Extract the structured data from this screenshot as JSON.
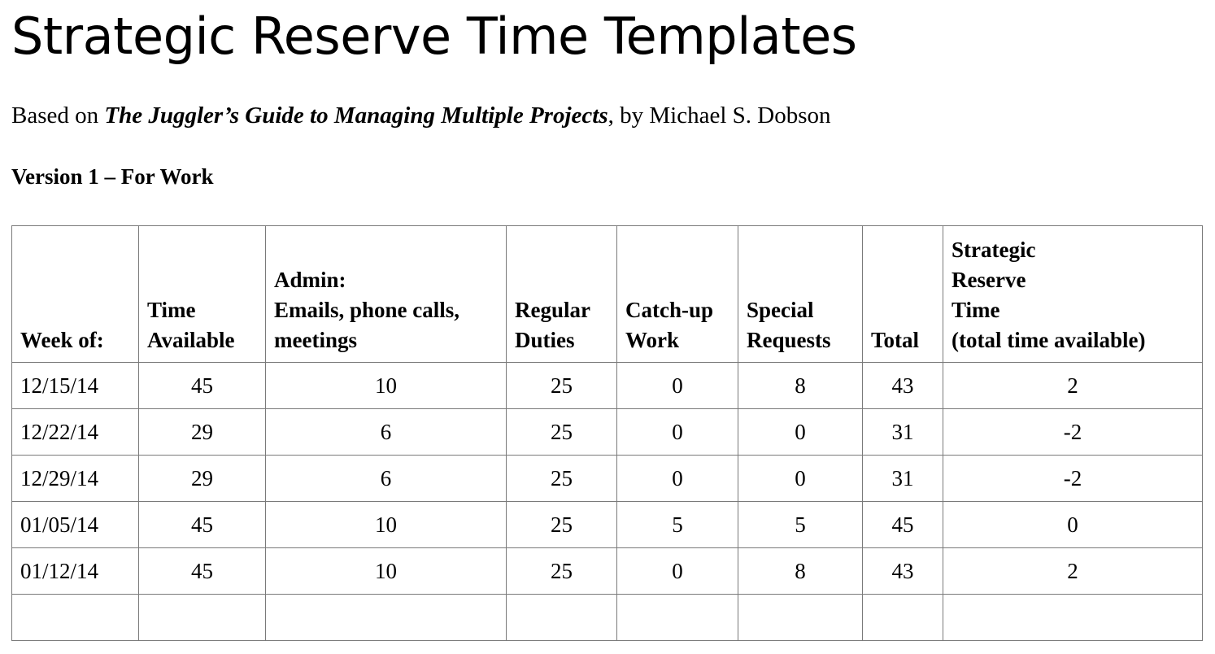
{
  "document": {
    "title": "Strategic Reserve Time Templates",
    "byline": {
      "prefix": "Based on ",
      "book_title": "The Juggler’s Guide to Managing Multiple Projects",
      "suffix": ", by Michael S. Dobson"
    },
    "section_heading": "Version 1 – For Work"
  },
  "table": {
    "headers": {
      "week": [
        "Week of:"
      ],
      "time_available": [
        "Time",
        "Available"
      ],
      "admin": [
        "Admin:",
        "Emails, phone calls,",
        "meetings"
      ],
      "regular_duties": [
        "Regular",
        "Duties"
      ],
      "catch_up": [
        "Catch-up",
        "Work"
      ],
      "special_requests": [
        "Special",
        "Requests"
      ],
      "total": [
        "Total"
      ],
      "strategic_reserve": [
        "Strategic",
        "Reserve",
        "Time",
        "(total time available)"
      ]
    },
    "rows": [
      [
        "12/15/14",
        "45",
        "10",
        "25",
        "0",
        "8",
        "43",
        "2"
      ],
      [
        "12/22/14",
        "29",
        "6",
        "25",
        "0",
        "0",
        "31",
        "-2"
      ],
      [
        "12/29/14",
        "29",
        "6",
        "25",
        "0",
        "0",
        "31",
        "-2"
      ],
      [
        "01/05/14",
        "45",
        "10",
        "25",
        "5",
        "5",
        "45",
        "0"
      ],
      [
        "01/12/14",
        "45",
        "10",
        "25",
        "0",
        "8",
        "43",
        "2"
      ],
      [
        "",
        "",
        "",
        "",
        "",
        "",
        "",
        ""
      ]
    ]
  }
}
